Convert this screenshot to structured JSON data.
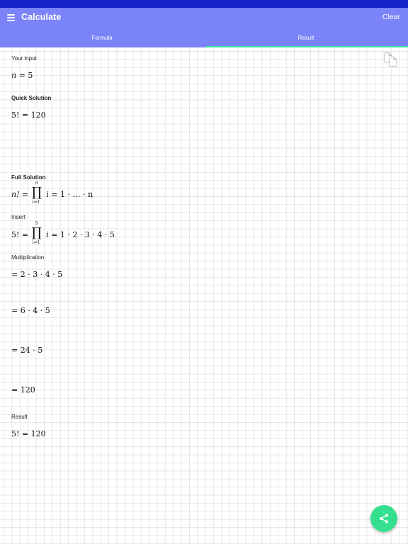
{
  "app_bar": {
    "title": "Calculate",
    "menu_icon": "hamburger-menu-icon",
    "clear_label": "Clear"
  },
  "tabs": [
    {
      "label": "Formula",
      "selected": false
    },
    {
      "label": "Result",
      "selected": true
    }
  ],
  "colors": {
    "status_bar": "#1424c8",
    "app_bar": "#7a83f7",
    "tab_indicator": "#3ce4a6",
    "fab": "#34e08f"
  },
  "result": {
    "your_input_label": "Your input",
    "input_expr": {
      "lhs": "n",
      "rhs": "5"
    },
    "quick_solution_label": "Quick Solution",
    "quick_expr": {
      "lhs": "5!",
      "rhs": "120"
    },
    "full_solution_label": "Full Solution",
    "formula": {
      "lhs": "n!",
      "upper": "n",
      "lower": "i=1",
      "body": "i",
      "rhs": "1 · … · n"
    },
    "insert_label": "Insert",
    "insert": {
      "lhs": "5!",
      "upper": "5",
      "lower": "i=1",
      "body": "i",
      "rhs": "1 · 2 · 3 · 4 · 5"
    },
    "multiplication_label": "Multiplication",
    "steps": [
      "2 · 3 · 4 · 5",
      "6 · 4 · 5",
      "24 · 5",
      "120"
    ],
    "result_label": "Result",
    "final_expr": {
      "lhs": "5!",
      "rhs": "120"
    }
  },
  "icons": {
    "copy": "copy-icon",
    "share": "share-icon"
  }
}
